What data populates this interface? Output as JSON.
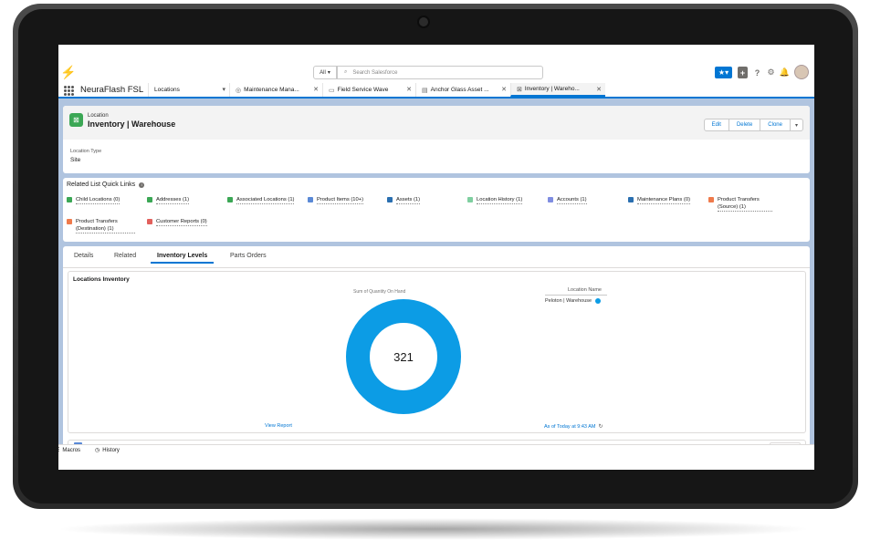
{
  "header": {
    "search_scope": "All",
    "search_placeholder": "Search Salesforce"
  },
  "nav": {
    "app_name": "NeuraFlash FSL",
    "object_tab": "Locations",
    "tabs": [
      {
        "label": "Maintenance Mana..."
      },
      {
        "label": "Field Service Wave"
      },
      {
        "label": "Anchor Glass Asset ..."
      },
      {
        "label": "Inventory | Wareho..."
      }
    ]
  },
  "record": {
    "object_type": "Location",
    "name": "Inventory | Warehouse",
    "buttons": [
      "Edit",
      "Delete",
      "Clone"
    ],
    "fields": [
      {
        "label": "Location Type",
        "value": "Site"
      }
    ]
  },
  "quick_links": {
    "title": "Related List Quick Links",
    "items": [
      {
        "label": "Child Locations (0)",
        "color": "#3ba755"
      },
      {
        "label": "Addresses (1)",
        "color": "#3ba755"
      },
      {
        "label": "Associated Locations (1)",
        "color": "#3ba755"
      },
      {
        "label": "Product Items (10+)",
        "color": "#5a89d6"
      },
      {
        "label": "Assets (1)",
        "color": "#2a6fb0"
      },
      {
        "label": "Location History (1)",
        "color": "#7fcfa0"
      },
      {
        "label": "Accounts (1)",
        "color": "#7f8de1"
      },
      {
        "label": "Maintenance Plans (0)",
        "color": "#2a6fb0"
      },
      {
        "label": "Product Transfers (Source) (1)",
        "color": "#ef7a4b"
      },
      {
        "label": "Product Transfers (Destination) (1)",
        "color": "#ef7a4b"
      },
      {
        "label": "Customer Reports (0)",
        "color": "#e2605c"
      }
    ]
  },
  "tabs": {
    "items": [
      "Details",
      "Related",
      "Inventory Levels",
      "Parts Orders"
    ],
    "active": "Inventory Levels"
  },
  "inventory_card": {
    "title": "Locations Inventory",
    "view_report": "View Report",
    "as_of": "As of Today at 9:43 AM"
  },
  "chart_data": {
    "type": "pie",
    "title": "Sum of Quantity On Hand",
    "legend_title": "Location Name",
    "legend_position": "top-right",
    "center_value": "321",
    "slices": [
      {
        "label": "Peloton | Warehouse",
        "value": 321,
        "color": "#0c9ce5"
      }
    ]
  },
  "utility_bar": {
    "items": [
      "Macros",
      "History"
    ]
  }
}
